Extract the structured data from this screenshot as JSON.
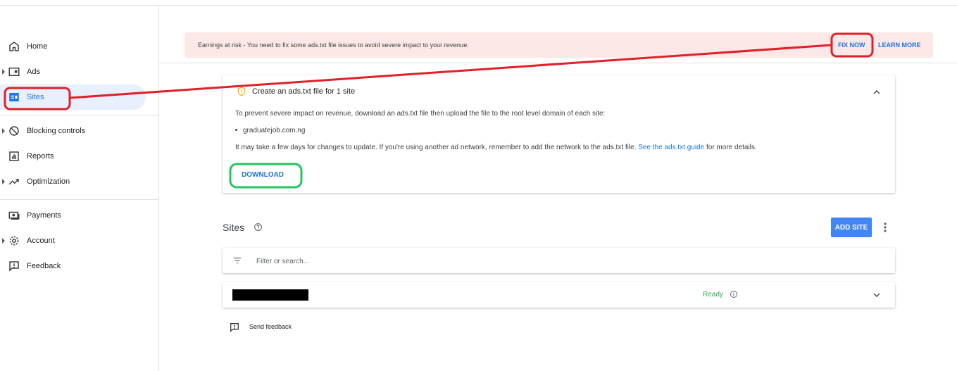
{
  "sidebar": {
    "items": [
      {
        "label": "Home",
        "icon": "home-icon"
      },
      {
        "label": "Ads",
        "icon": "ads-icon"
      },
      {
        "label": "Sites",
        "icon": "sites-icon",
        "active": true
      },
      {
        "label": "Blocking controls",
        "icon": "block-icon"
      },
      {
        "label": "Reports",
        "icon": "reports-icon"
      },
      {
        "label": "Optimization",
        "icon": "trending-up-icon"
      },
      {
        "label": "Payments",
        "icon": "payments-icon"
      },
      {
        "label": "Account",
        "icon": "gear-icon"
      },
      {
        "label": "Feedback",
        "icon": "feedback-icon"
      }
    ]
  },
  "banner": {
    "text": "Earnings at risk - You need to fix some ads.txt file issues to avoid severe impact to your revenue.",
    "fix_now": "FIX NOW",
    "learn_more": "LEARN MORE"
  },
  "adstxt_card": {
    "title": "Create an ads.txt file for 1 site",
    "description": "To prevent severe impact on revenue, download an ads.txt file then upload the file to the root level domain of each site:",
    "site": "graduatejob.com.ng",
    "note_before": "It may take a few days for changes to update. If you're using another ad network, remember to add the network to the ads.txt file.",
    "link": "See the ads.txt guide",
    "note_after": "for more details.",
    "download": "DOWNLOAD"
  },
  "sites": {
    "title": "Sites",
    "add_site": "ADD SITE",
    "filter_placeholder": "Filter or search...",
    "row_status": "Ready"
  },
  "footer": {
    "send_feedback": "Send feedback"
  },
  "colors": {
    "accent": "#1a73e8",
    "banner_bg": "#fce8e6",
    "ready": "#34a853",
    "annotation_red": "#e0202a",
    "annotation_green": "#22c55e"
  }
}
